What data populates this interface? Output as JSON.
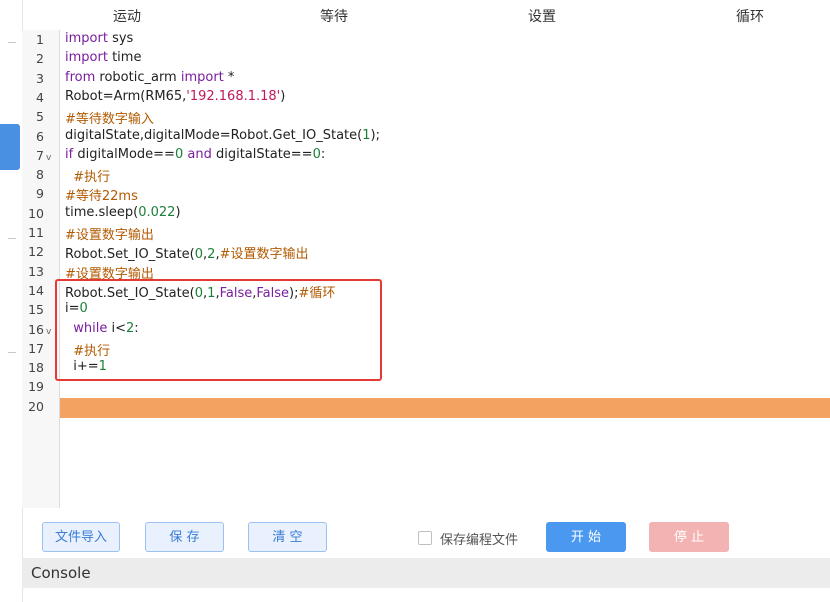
{
  "menu": {
    "items": [
      "运动",
      "等待",
      "设置",
      "循环"
    ]
  },
  "editor": {
    "lines": [
      {
        "n": "1",
        "code": [
          {
            "t": "import",
            "c": "kw"
          },
          {
            "t": " sys"
          }
        ]
      },
      {
        "n": "2",
        "code": [
          {
            "t": "import",
            "c": "kw"
          },
          {
            "t": " time"
          }
        ]
      },
      {
        "n": "3",
        "code": [
          {
            "t": "from",
            "c": "kw"
          },
          {
            "t": " robotic_arm "
          },
          {
            "t": "import",
            "c": "kw"
          },
          {
            "t": " *"
          }
        ]
      },
      {
        "n": "4",
        "code": [
          {
            "t": "Robot=Arm(RM65,"
          },
          {
            "t": "'192.168.1.18'",
            "c": "str"
          },
          {
            "t": ")"
          }
        ]
      },
      {
        "n": "5",
        "code": [
          {
            "t": "#等待数字输入",
            "c": "cm"
          }
        ]
      },
      {
        "n": "6",
        "code": [
          {
            "t": "digitalState,digitalMode=Robot.Get_IO_State("
          },
          {
            "t": "1",
            "c": "num"
          },
          {
            "t": ");"
          }
        ]
      },
      {
        "n": "7",
        "fold": "v",
        "code": [
          {
            "t": "if",
            "c": "kw"
          },
          {
            "t": " digitalMode=="
          },
          {
            "t": "0",
            "c": "num"
          },
          {
            "t": " "
          },
          {
            "t": "and",
            "c": "kw"
          },
          {
            "t": " digitalState=="
          },
          {
            "t": "0",
            "c": "num"
          },
          {
            "t": ":"
          }
        ]
      },
      {
        "n": "8",
        "code": [
          {
            "t": "  #执行",
            "c": "cm"
          }
        ]
      },
      {
        "n": "9",
        "code": [
          {
            "t": "#等待22ms",
            "c": "cm"
          }
        ]
      },
      {
        "n": "10",
        "code": [
          {
            "t": "time.sleep("
          },
          {
            "t": "0.022",
            "c": "num"
          },
          {
            "t": ")"
          }
        ]
      },
      {
        "n": "11",
        "code": [
          {
            "t": "#设置数字输出",
            "c": "cm"
          }
        ]
      },
      {
        "n": "12",
        "code": [
          {
            "t": "Robot.Set_IO_State("
          },
          {
            "t": "0",
            "c": "num"
          },
          {
            "t": ","
          },
          {
            "t": "2",
            "c": "num"
          },
          {
            "t": ","
          },
          {
            "t": "#设置数字输出",
            "c": "cm"
          }
        ]
      },
      {
        "n": "13",
        "code": [
          {
            "t": "#设置数字输出",
            "c": "cm"
          }
        ]
      },
      {
        "n": "14",
        "code": [
          {
            "t": "Robot.Set_IO_State("
          },
          {
            "t": "0",
            "c": "num"
          },
          {
            "t": ","
          },
          {
            "t": "1",
            "c": "num"
          },
          {
            "t": ","
          },
          {
            "t": "False",
            "c": "kw"
          },
          {
            "t": ","
          },
          {
            "t": "False",
            "c": "kw"
          },
          {
            "t": ");"
          },
          {
            "t": "#循环",
            "c": "cm"
          }
        ]
      },
      {
        "n": "15",
        "code": [
          {
            "t": "i="
          },
          {
            "t": "0",
            "c": "num"
          }
        ]
      },
      {
        "n": "16",
        "fold": "v",
        "code": [
          {
            "t": "  "
          },
          {
            "t": "while",
            "c": "kw"
          },
          {
            "t": " i<"
          },
          {
            "t": "2",
            "c": "num"
          },
          {
            "t": ":"
          }
        ]
      },
      {
        "n": "17",
        "code": [
          {
            "t": "  #执行",
            "c": "cm"
          }
        ]
      },
      {
        "n": "18",
        "code": [
          {
            "t": "  i+="
          },
          {
            "t": "1",
            "c": "num"
          }
        ]
      },
      {
        "n": "19",
        "code": []
      },
      {
        "n": "20",
        "code": []
      }
    ]
  },
  "actions": {
    "import_label": "文件导入",
    "save_label": "保 存",
    "clear_label": "清 空",
    "save_file_label": "保存编程文件",
    "save_file_checked": false,
    "start_label": "开 始",
    "stop_label": "停 止"
  },
  "console": {
    "title": "Console"
  },
  "colors": {
    "accent": "#4a90e2",
    "current_line": "#f4a261",
    "box": "#e53935",
    "start": "#4a98f0",
    "stop": "#f4b3b3"
  }
}
